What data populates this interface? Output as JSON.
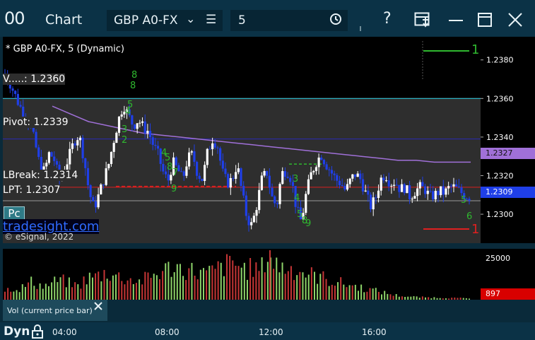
{
  "titlebar": {
    "app_icon": "00",
    "title": "Chart",
    "symbol": "GBP A0-FX",
    "interval": "5",
    "help": "?",
    "icons": [
      "chevron-down-icon",
      "list-icon",
      "clock-icon",
      "help-icon",
      "inbox-icon",
      "minimize-icon",
      "maximize-icon",
      "close-icon"
    ]
  },
  "chart": {
    "header": "* GBP A0-FX, 5 (Dynamic)",
    "watermark_brand": "tradesight.com",
    "watermark_copyright": "© eSignal, 2022",
    "pc_button": "Pc",
    "left_labels": {
      "vwap": "V.....: 1.2360",
      "pivot": "Pivot: 1.2339",
      "lbreak": "LBreak: 1.2314",
      "lpt": "LPT: 1.2307"
    },
    "markers": {
      "top_right": "1",
      "bottom_right": "1",
      "count_labels": [
        "8",
        "8",
        "5",
        "4",
        "3",
        "2",
        "4",
        "5",
        "8",
        "7",
        "9",
        "3",
        "4",
        "5",
        "8",
        "9",
        "5",
        "6"
      ]
    }
  },
  "price_axis": {
    "ticks": [
      "1.2380",
      "1.2360",
      "1.2340",
      "1.2320",
      "1.2300"
    ],
    "badge_purple": "1.2327",
    "badge_blue": "1.2309"
  },
  "volume": {
    "axis_tick": "25000",
    "badge_red": "897",
    "study_label": "Vol (current price bar)"
  },
  "bottombar": {
    "mode": "Dyn",
    "time_ticks": [
      "04:00",
      "08:00",
      "12:00",
      "16:00"
    ]
  },
  "colors": {
    "up_candle": "#ffffff",
    "down_candle": "#1f3fe8",
    "vwap_line": "#27c4d8",
    "pivot_line": "#2a2ab5",
    "lbreak_line": "#d82020",
    "lpt_line": "#9a9a9a",
    "ma_line": "#a070d8",
    "counter_text": "#2fb82f",
    "volume_up": "#8ed46a",
    "volume_down": "#c63636"
  },
  "chart_data": {
    "type": "candlestick",
    "title": "* GBP A0-FX, 5 (Dynamic)",
    "x_ticks": [
      "04:00",
      "08:00",
      "12:00",
      "16:00"
    ],
    "y_ticks": [
      1.238,
      1.236,
      1.234,
      1.232,
      1.23
    ],
    "ylim": [
      1.2285,
      1.2392
    ],
    "levels": {
      "vwap": 1.236,
      "pivot": 1.2339,
      "lbreak": 1.2314,
      "lpt": 1.2307
    },
    "last_price": 1.2309,
    "moving_average_last": 1.2327,
    "close_path": [
      1.2373,
      1.2368,
      1.2362,
      1.2356,
      1.2352,
      1.2346,
      1.2338,
      1.2326,
      1.2322,
      1.2332,
      1.2328,
      1.2318,
      1.2323,
      1.233,
      1.2338,
      1.2341,
      1.2329,
      1.2312,
      1.2303,
      1.231,
      1.2318,
      1.2326,
      1.2338,
      1.2349,
      1.2357,
      1.2351,
      1.2346,
      1.2349,
      1.2345,
      1.2343,
      1.2336,
      1.2331,
      1.2322,
      1.2317,
      1.2327,
      1.2323,
      1.2318,
      1.2329,
      1.2331,
      1.2321,
      1.2318,
      1.2332,
      1.2339,
      1.2336,
      1.2322,
      1.2316,
      1.2318,
      1.2326,
      1.2311,
      1.2298,
      1.2294,
      1.2305,
      1.2318,
      1.2322,
      1.2309,
      1.2304,
      1.2321,
      1.2323,
      1.2318,
      1.2303,
      1.2296,
      1.2311,
      1.2321,
      1.2327,
      1.2331,
      1.2326,
      1.2322,
      1.2318,
      1.2316,
      1.2312,
      1.2318,
      1.2321,
      1.2318,
      1.2311,
      1.2304,
      1.2308,
      1.2318,
      1.2321,
      1.2316,
      1.2317,
      1.2313,
      1.2314,
      1.2309,
      1.2312,
      1.2314,
      1.2313,
      1.2309,
      1.231,
      1.2312,
      1.2311,
      1.2314,
      1.2314,
      1.2312,
      1.231,
      1.2309
    ],
    "moving_average": [
      1.2356,
      1.2352,
      1.2348,
      1.2346,
      1.2344,
      1.2342,
      1.2341,
      1.234,
      1.2339,
      1.2338,
      1.2337,
      1.2336,
      1.2335,
      1.2334,
      1.2333,
      1.2332,
      1.2331,
      1.233,
      1.2329,
      1.2328,
      1.2328,
      1.2327,
      1.2327,
      1.2327
    ],
    "volume_series": {
      "name": "Vol (current price bar)",
      "latest": 897,
      "axis_tick": 25000,
      "values": [
        6000,
        8000,
        7000,
        9000,
        12000,
        10000,
        9000,
        11000,
        13000,
        12000,
        10000,
        9000,
        14000,
        15000,
        16000,
        18000,
        17000,
        15000,
        14000,
        13000,
        12000,
        14000,
        16000,
        18000,
        20000,
        22000,
        21000,
        20000,
        19000,
        18000,
        17000,
        19000,
        21000,
        23000,
        24000,
        22000,
        20000,
        21000,
        19000,
        30000,
        24000,
        22000,
        21000,
        20000,
        19000,
        17000,
        16000,
        15000,
        13000,
        12000,
        11000,
        10000,
        9000,
        8000,
        7000,
        6000,
        5000,
        4000,
        3000,
        2500,
        2000,
        1800,
        1600,
        1500,
        1400,
        1300,
        1200,
        1100,
        1000,
        897
      ]
    }
  }
}
